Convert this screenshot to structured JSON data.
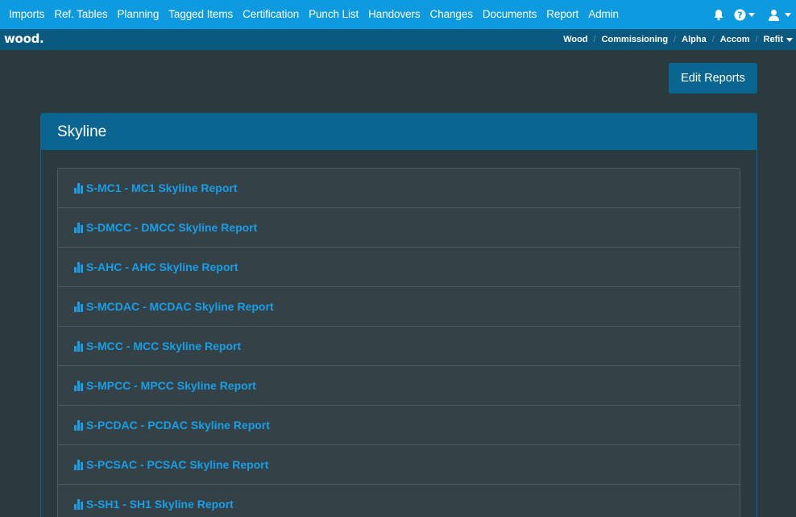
{
  "topnav": {
    "items": [
      "Imports",
      "Ref. Tables",
      "Planning",
      "Tagged Items",
      "Certification",
      "Punch List",
      "Handovers",
      "Changes",
      "Documents",
      "Report",
      "Admin"
    ],
    "bell_icon": "bell-icon",
    "help_icon": "help-icon",
    "user_icon": "user-icon"
  },
  "logo": "wood.",
  "breadcrumbs": [
    "Wood",
    "Commissioning",
    "Alpha",
    "Accom",
    "Refit"
  ],
  "edit_button": "Edit Reports",
  "panel": {
    "title": "Skyline",
    "reports": [
      "S-MC1 - MC1 Skyline Report",
      "S-DMCC - DMCC Skyline Report",
      "S-AHC - AHC Skyline Report",
      "S-MCDAC - MCDAC Skyline Report",
      "S-MCC - MCC Skyline Report",
      "S-MPCC - MPCC Skyline Report",
      "S-PCDAC - PCDAC Skyline Report",
      "S-PCSAC - PCSAC Skyline Report",
      "S-SH1 - SH1 Skyline Report"
    ]
  },
  "colors": {
    "topnav": "#0d9adf",
    "subbar": "#0a5980",
    "background": "#2b3a3f",
    "panel_header": "#0a6690",
    "link": "#1a9ee6"
  }
}
